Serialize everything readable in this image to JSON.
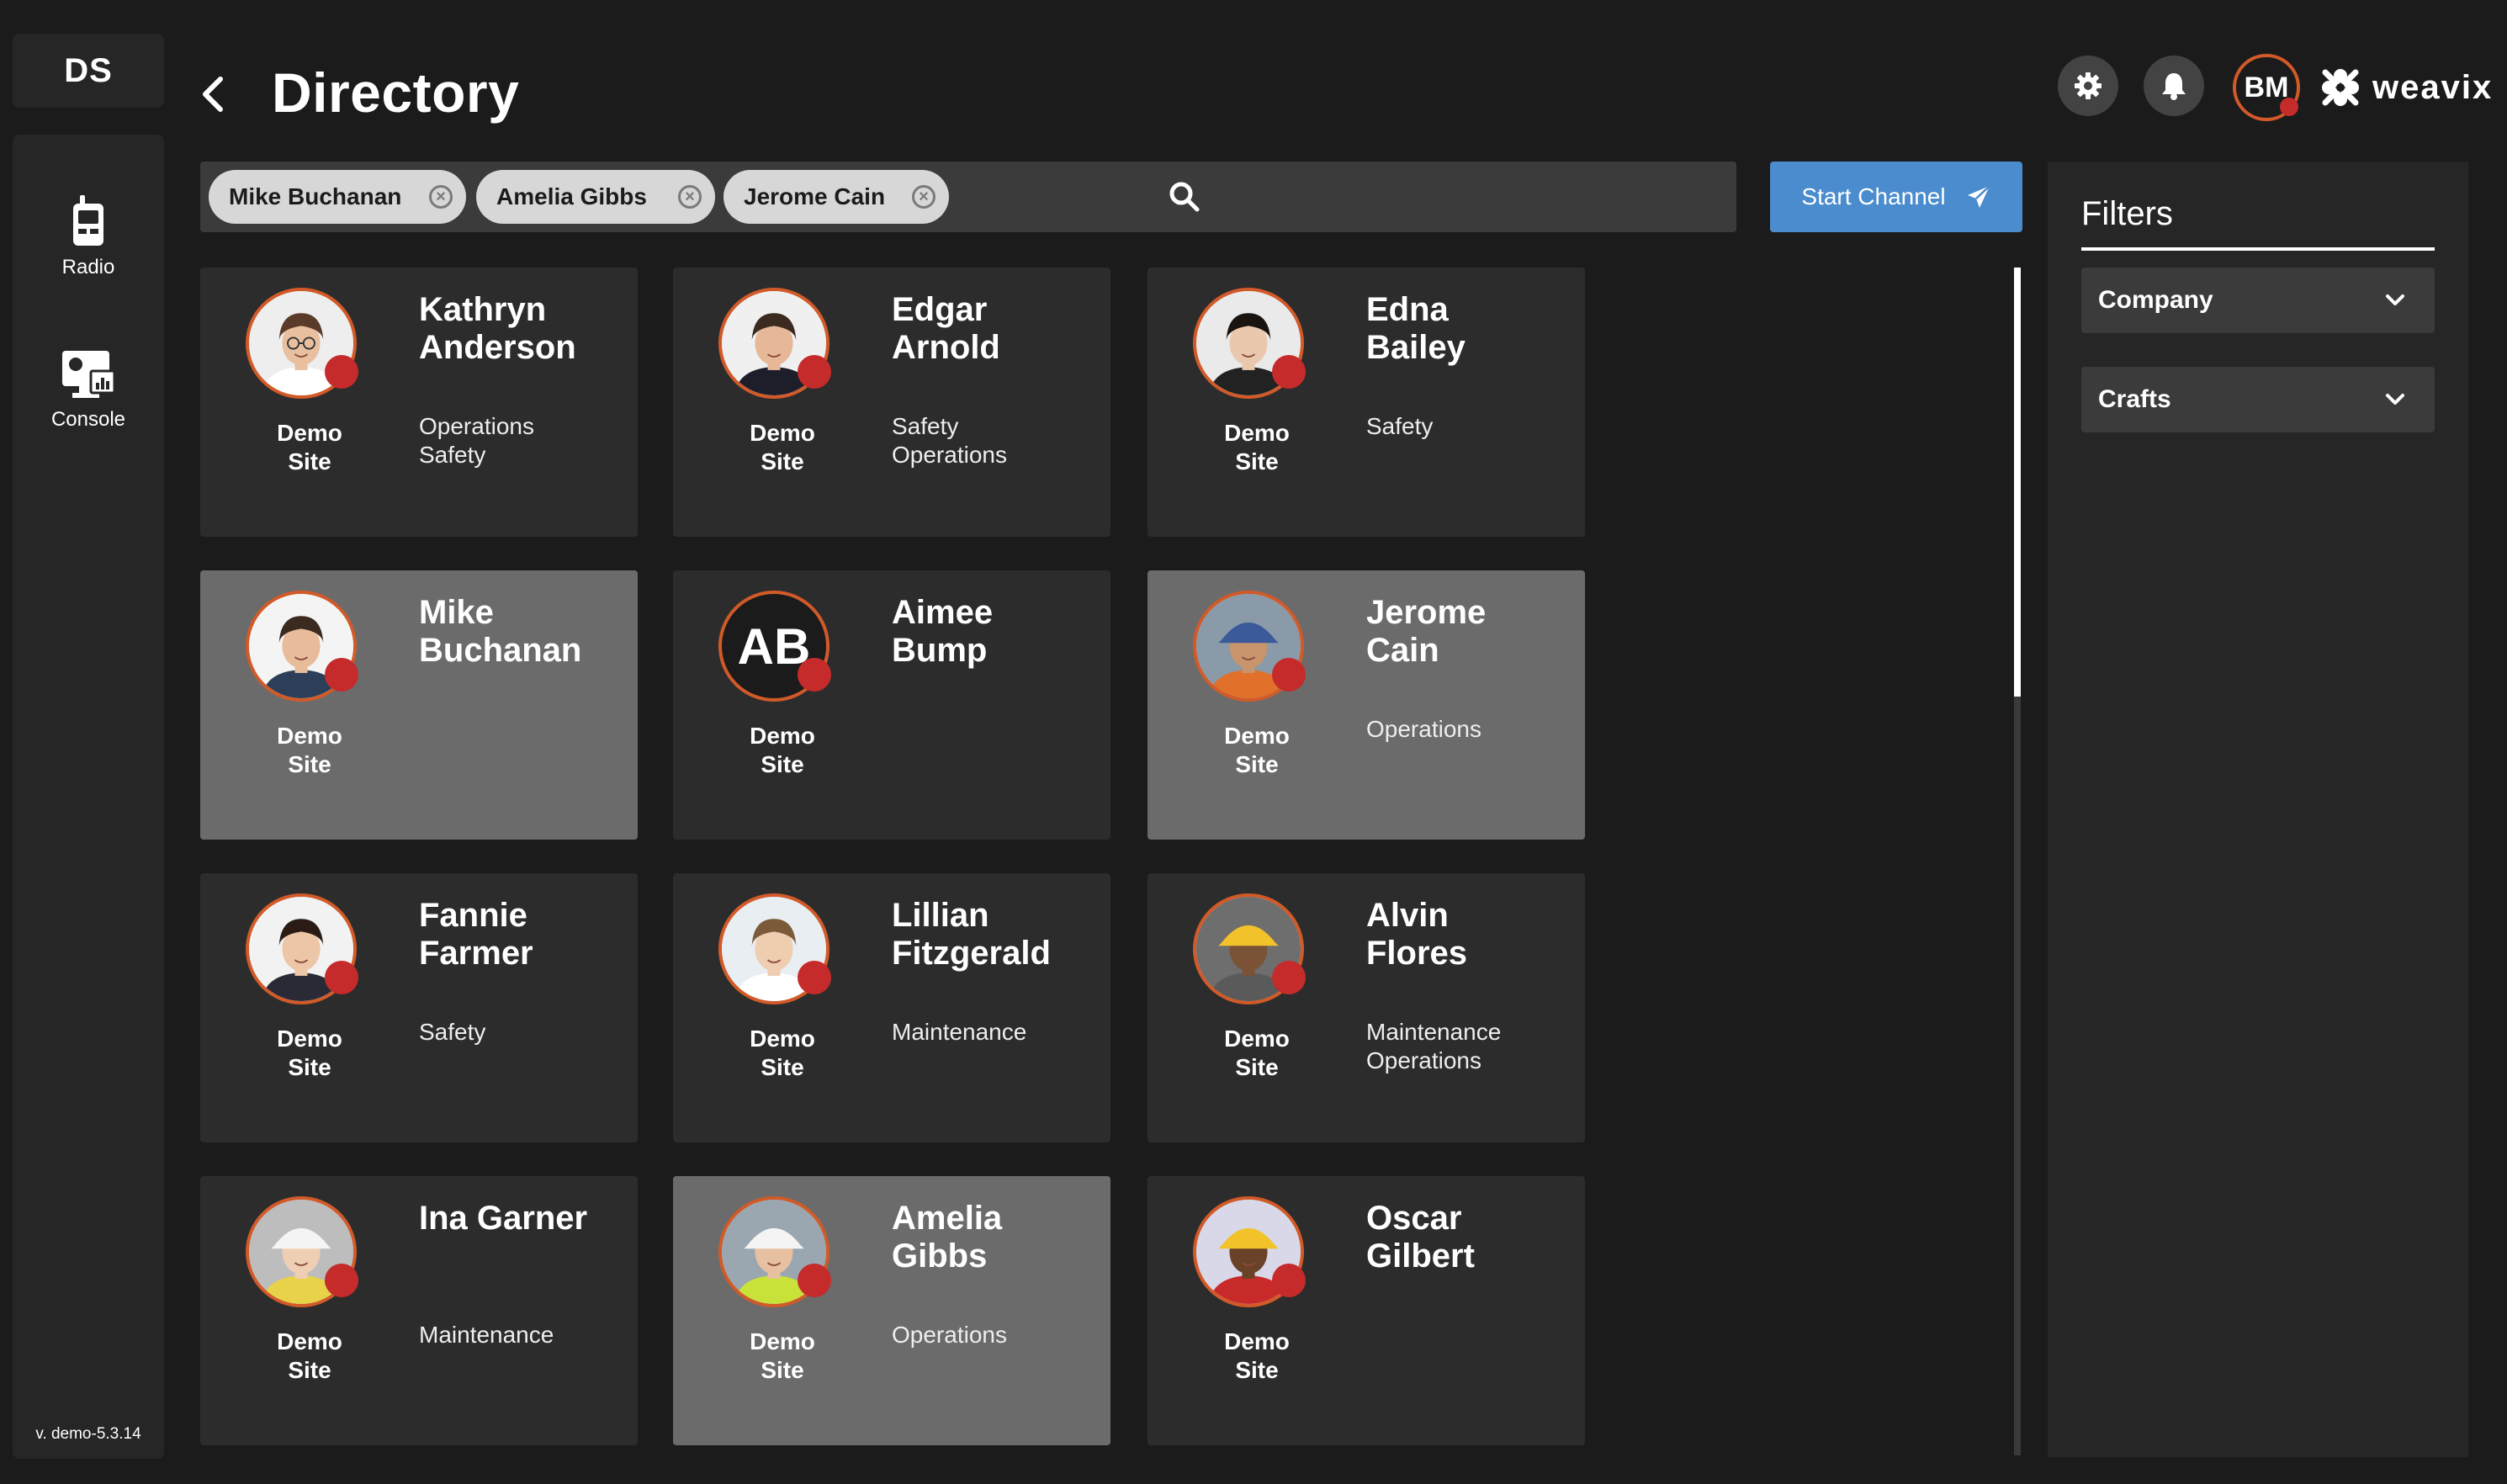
{
  "app": {
    "workspace_badge": "DS",
    "title": "Directory",
    "version": "v. demo-5.3.14",
    "brand": "weavix",
    "user_initials": "BM"
  },
  "nav": {
    "radio_label": "Radio",
    "console_label": "Console"
  },
  "search": {
    "chips": [
      {
        "label": "Mike Buchanan"
      },
      {
        "label": "Amelia Gibbs"
      },
      {
        "label": "Jerome Cain"
      }
    ],
    "clear_glyph": "×"
  },
  "actions": {
    "start_channel_label": "Start Channel"
  },
  "filters": {
    "title": "Filters",
    "company_label": "Company",
    "crafts_label": "Crafts"
  },
  "people": [
    {
      "name": "Kathryn\nAnderson",
      "site": "Demo\nSite",
      "crafts": "Operations\nSafety",
      "selected": false,
      "photo": "woman-glasses"
    },
    {
      "name": "Edgar\nArnold",
      "site": "Demo\nSite",
      "crafts": "Safety\nOperations",
      "selected": false,
      "photo": "man-suit"
    },
    {
      "name": "Edna\nBailey",
      "site": "Demo\nSite",
      "crafts": "Safety",
      "selected": false,
      "photo": "woman-dark-hair"
    },
    {
      "name": "Mike\nBuchanan",
      "site": "Demo\nSite",
      "crafts": "",
      "selected": true,
      "photo": "man-smiling"
    },
    {
      "name": "Aimee\nBump",
      "site": "Demo\nSite",
      "crafts": "",
      "selected": false,
      "initials": "AB"
    },
    {
      "name": "Jerome\nCain",
      "site": "Demo\nSite",
      "crafts": "Operations",
      "selected": true,
      "photo": "worker-hardhat-blue"
    },
    {
      "name": "Fannie\nFarmer",
      "site": "Demo\nSite",
      "crafts": "Safety",
      "selected": false,
      "photo": "woman-business"
    },
    {
      "name": "Lillian\nFitzgerald",
      "site": "Demo\nSite",
      "crafts": "Maintenance",
      "selected": false,
      "photo": "woman-blonde"
    },
    {
      "name": "Alvin\nFlores",
      "site": "Demo\nSite",
      "crafts": "Maintenance\nOperations",
      "selected": false,
      "photo": "worker-hardhat-yellow"
    },
    {
      "name": "Ina Garner",
      "site": "Demo\nSite",
      "crafts": "Maintenance",
      "selected": false,
      "photo": "worker-hardhat-white"
    },
    {
      "name": "Amelia\nGibbs",
      "site": "Demo\nSite",
      "crafts": "Operations",
      "selected": true,
      "photo": "worker-vest"
    },
    {
      "name": "Oscar\nGilbert",
      "site": "Demo\nSite",
      "crafts": "",
      "selected": false,
      "photo": "worker-hardhat-yellow-smiling"
    }
  ],
  "colors": {
    "accent_blue": "#4a8ccd",
    "avatar_ring": "#d25a28",
    "status_red": "#c62b2b",
    "selected_card": "#6b6b6b",
    "card": "#2c2c2c"
  }
}
